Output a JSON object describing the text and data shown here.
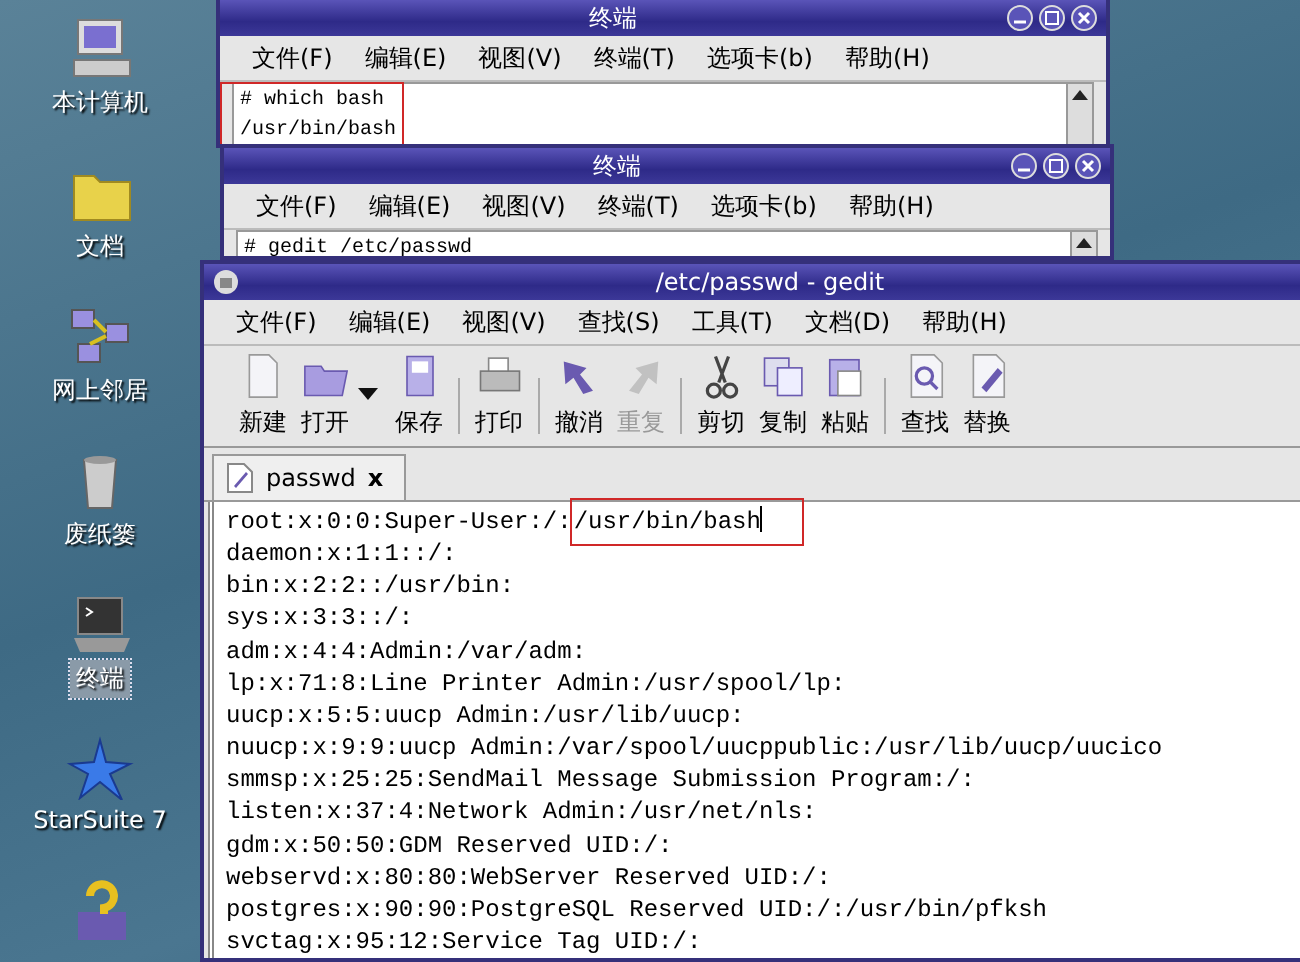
{
  "desktop_icons": [
    {
      "label": "本计算机",
      "kind": "computer",
      "selected": false
    },
    {
      "label": "文档",
      "kind": "folder",
      "selected": false
    },
    {
      "label": "网上邻居",
      "kind": "network",
      "selected": false
    },
    {
      "label": "废纸篓",
      "kind": "trash",
      "selected": false
    },
    {
      "label": "终端",
      "kind": "terminal",
      "selected": true
    },
    {
      "label": "StarSuite 7",
      "kind": "star",
      "selected": false
    },
    {
      "kind": "help",
      "selected": false
    }
  ],
  "terminals": [
    {
      "title": "终端",
      "menu": [
        "文件(F)",
        "编辑(E)",
        "视图(V)",
        "终端(T)",
        "选项卡(b)",
        "帮助(H)"
      ],
      "output": {
        "highlighted": true,
        "lines": [
          "# which bash",
          "/usr/bin/bash"
        ]
      }
    },
    {
      "title": "终端",
      "menu": [
        "文件(F)",
        "编辑(E)",
        "视图(V)",
        "终端(T)",
        "选项卡(b)",
        "帮助(H)"
      ],
      "output": {
        "highlighted": false,
        "lines": [
          "# gedit /etc/passwd"
        ]
      }
    }
  ],
  "editor": {
    "title": "/etc/passwd - gedit",
    "menu": [
      "文件(F)",
      "编辑(E)",
      "视图(V)",
      "查找(S)",
      "工具(T)",
      "文档(D)",
      "帮助(H)"
    ],
    "toolbar": [
      {
        "kind": "new",
        "label": "新建",
        "disabled": false
      },
      {
        "kind": "open",
        "label": "打开",
        "disabled": false
      },
      {
        "kind": "dropdown"
      },
      {
        "kind": "save",
        "label": "保存",
        "disabled": false
      },
      {
        "kind": "separator"
      },
      {
        "kind": "print",
        "label": "打印",
        "disabled": false
      },
      {
        "kind": "separator"
      },
      {
        "kind": "undo",
        "label": "撤消",
        "disabled": false
      },
      {
        "kind": "redo",
        "label": "重复",
        "disabled": true
      },
      {
        "kind": "separator"
      },
      {
        "kind": "cut",
        "label": "剪切",
        "disabled": false
      },
      {
        "kind": "copy",
        "label": "复制",
        "disabled": false
      },
      {
        "kind": "paste",
        "label": "粘贴",
        "disabled": false
      },
      {
        "kind": "separator"
      },
      {
        "kind": "find",
        "label": "查找",
        "disabled": false
      },
      {
        "kind": "replace",
        "label": "替换",
        "disabled": false
      }
    ],
    "tabs": [
      {
        "label": "passwd",
        "close": "x",
        "selected": true
      }
    ],
    "lines": [
      {
        "text": "root:x:0:0:Super-User:/:",
        "highlight": "/usr/bin/bash"
      },
      {
        "text": "daemon:x:1:1::/:"
      },
      {
        "text": "bin:x:2:2::/usr/bin:"
      },
      {
        "text": "sys:x:3:3::/:"
      },
      {
        "text": "adm:x:4:4:Admin:/var/adm:"
      },
      {
        "text": "lp:x:71:8:Line Printer Admin:/usr/spool/lp:"
      },
      {
        "text": "uucp:x:5:5:uucp Admin:/usr/lib/uucp:"
      },
      {
        "text": "nuucp:x:9:9:uucp Admin:/var/spool/uucppublic:/usr/lib/uucp/uucico"
      },
      {
        "text": "smmsp:x:25:25:SendMail Message Submission Program:/:"
      },
      {
        "text": "listen:x:37:4:Network Admin:/usr/net/nls:"
      },
      {
        "text": "gdm:x:50:50:GDM Reserved UID:/:"
      },
      {
        "text": "webservd:x:80:80:WebServer Reserved UID:/:"
      },
      {
        "text": "postgres:x:90:90:PostgreSQL Reserved UID:/:/usr/bin/pfksh"
      },
      {
        "text": "svctag:x:95:12:Service Tag UID:/:"
      }
    ]
  }
}
